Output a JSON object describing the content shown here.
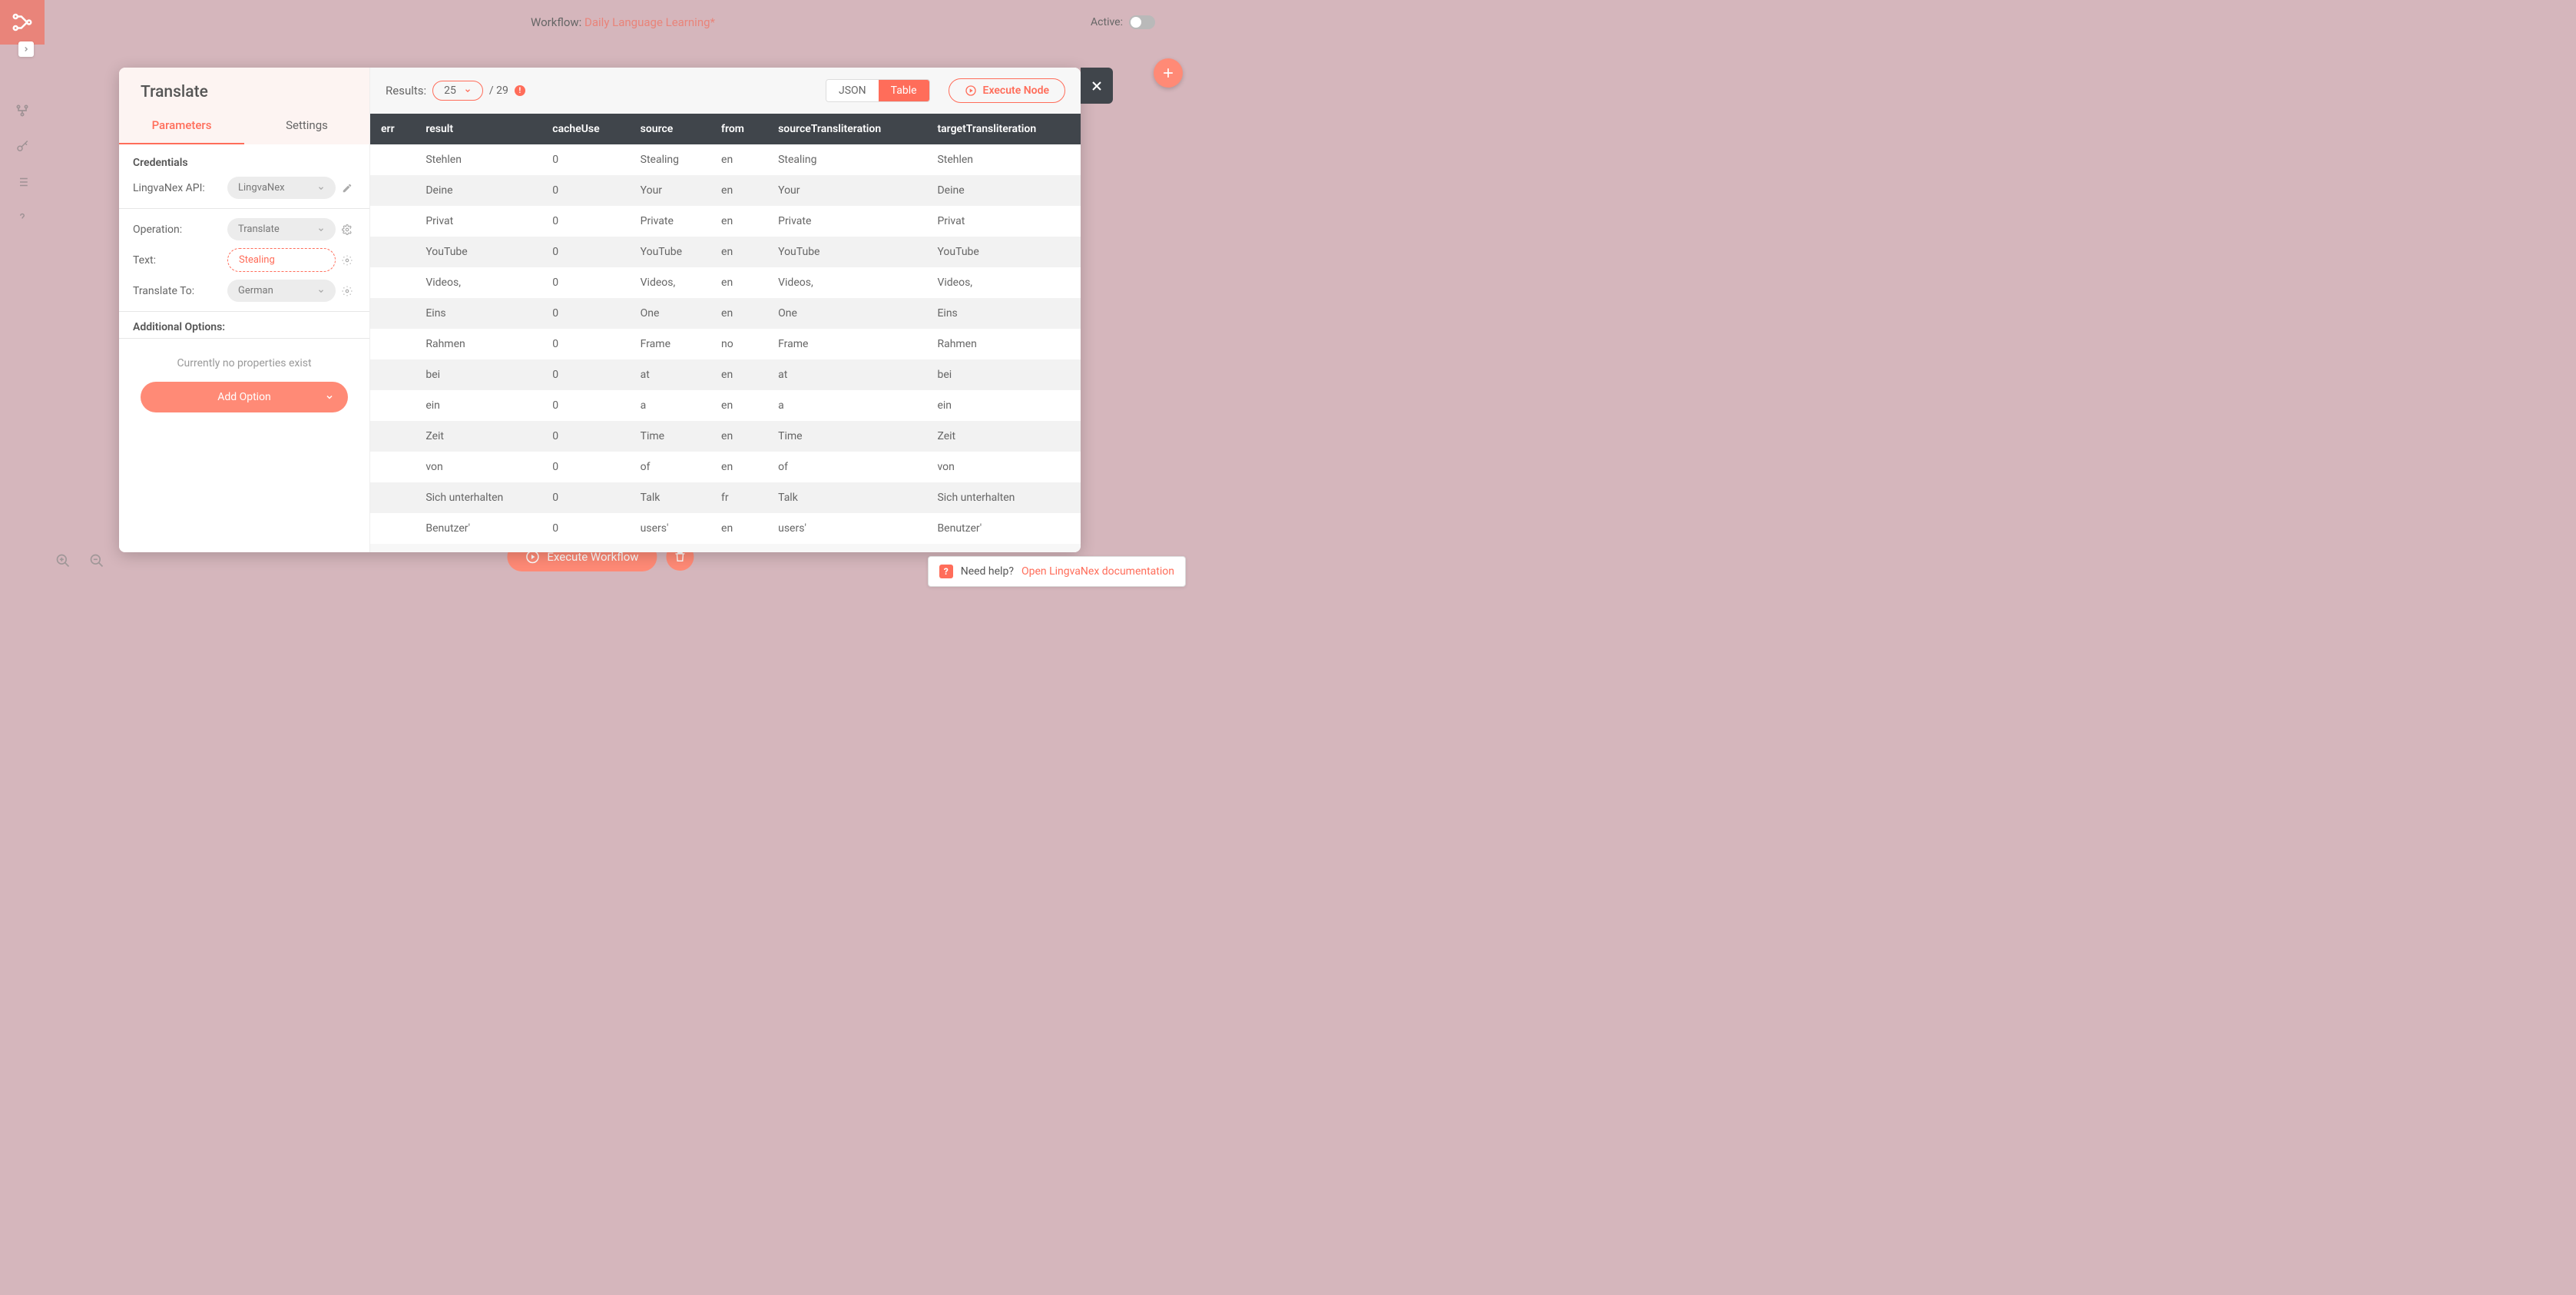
{
  "header": {
    "workflow_label": "Workflow: ",
    "workflow_name": "Daily Language Learning*",
    "active_label": "Active:"
  },
  "sidebar": {
    "icons": [
      "logo-icon",
      "workflow-icon",
      "key-icon",
      "list-icon",
      "help-icon"
    ]
  },
  "modal": {
    "title": "Translate",
    "tabs": {
      "parameters": "Parameters",
      "settings": "Settings"
    },
    "credentials_label": "Credentials",
    "cred_api_label": "LingvaNex API:",
    "cred_api_value": "LingvaNex",
    "fields": {
      "operation_label": "Operation:",
      "operation_value": "Translate",
      "text_label": "Text:",
      "text_value": "Stealing",
      "translate_to_label": "Translate To:",
      "translate_to_value": "German"
    },
    "additional_options_label": "Additional Options:",
    "no_properties_text": "Currently no properties exist",
    "add_option_label": "Add Option"
  },
  "results": {
    "label": "Results:",
    "page_size": "25",
    "total_sep": "/",
    "total": "29",
    "view_json": "JSON",
    "view_table": "Table",
    "execute_node": "Execute Node",
    "columns": [
      "err",
      "result",
      "cacheUse",
      "source",
      "from",
      "sourceTransliteration",
      "targetTransliteration"
    ],
    "rows": [
      {
        "err": "",
        "result": "Stehlen",
        "cacheUse": "0",
        "source": "Stealing",
        "from": "en",
        "sourceTransliteration": "Stealing",
        "targetTransliteration": "Stehlen"
      },
      {
        "err": "",
        "result": "Deine",
        "cacheUse": "0",
        "source": "Your",
        "from": "en",
        "sourceTransliteration": "Your",
        "targetTransliteration": "Deine"
      },
      {
        "err": "",
        "result": "Privat",
        "cacheUse": "0",
        "source": "Private",
        "from": "en",
        "sourceTransliteration": "Private",
        "targetTransliteration": "Privat"
      },
      {
        "err": "",
        "result": "YouTube",
        "cacheUse": "0",
        "source": "YouTube",
        "from": "en",
        "sourceTransliteration": "YouTube",
        "targetTransliteration": "YouTube"
      },
      {
        "err": "",
        "result": "Videos,",
        "cacheUse": "0",
        "source": "Videos,",
        "from": "en",
        "sourceTransliteration": "Videos,",
        "targetTransliteration": "Videos,"
      },
      {
        "err": "",
        "result": "Eins",
        "cacheUse": "0",
        "source": "One",
        "from": "en",
        "sourceTransliteration": "One",
        "targetTransliteration": "Eins"
      },
      {
        "err": "",
        "result": "Rahmen",
        "cacheUse": "0",
        "source": "Frame",
        "from": "no",
        "sourceTransliteration": "Frame",
        "targetTransliteration": "Rahmen"
      },
      {
        "err": "",
        "result": "bei",
        "cacheUse": "0",
        "source": "at",
        "from": "en",
        "sourceTransliteration": "at",
        "targetTransliteration": "bei"
      },
      {
        "err": "",
        "result": "ein",
        "cacheUse": "0",
        "source": "a",
        "from": "en",
        "sourceTransliteration": "a",
        "targetTransliteration": "ein"
      },
      {
        "err": "",
        "result": "Zeit",
        "cacheUse": "0",
        "source": "Time",
        "from": "en",
        "sourceTransliteration": "Time",
        "targetTransliteration": "Zeit"
      },
      {
        "err": "",
        "result": "von",
        "cacheUse": "0",
        "source": "of",
        "from": "en",
        "sourceTransliteration": "of",
        "targetTransliteration": "von"
      },
      {
        "err": "",
        "result": "Sich unterhalten",
        "cacheUse": "0",
        "source": "Talk",
        "from": "fr",
        "sourceTransliteration": "Talk",
        "targetTransliteration": "Sich unterhalten"
      },
      {
        "err": "",
        "result": "Benutzer'",
        "cacheUse": "0",
        "source": "users'",
        "from": "en",
        "sourceTransliteration": "users'",
        "targetTransliteration": "Benutzer'"
      }
    ]
  },
  "footer": {
    "execute_workflow": "Execute Workflow",
    "help_text": "Need help? ",
    "help_link": "Open LingvaNex documentation"
  }
}
